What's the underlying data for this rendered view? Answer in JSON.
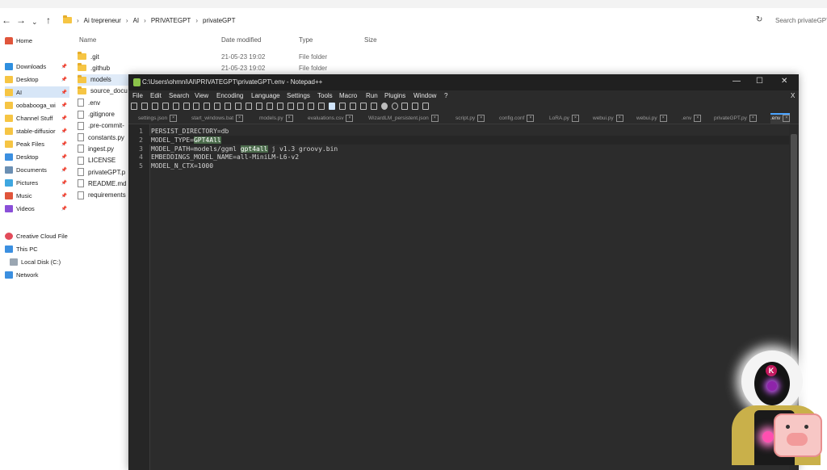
{
  "explorer": {
    "breadcrumbs": [
      "Ai trepreneur",
      "AI",
      "PRIVATEGPT",
      "privateGPT"
    ],
    "search_placeholder": "Search privateGPT",
    "columns": {
      "name": "Name",
      "date": "Date modified",
      "type": "Type",
      "size": "Size"
    },
    "sidebar": {
      "home": "Home",
      "quick_access": [
        {
          "label": "Downloads",
          "color": "#2f8fdf"
        },
        {
          "label": "Desktop",
          "color": "#f6c544"
        },
        {
          "label": "AI",
          "color": "#f6c544"
        },
        {
          "label": "oobabooga_wi",
          "color": "#f6c544"
        },
        {
          "label": "Channel Stuff",
          "color": "#f6c544"
        },
        {
          "label": "stable-diffusior",
          "color": "#f6c544"
        },
        {
          "label": "Peak Files",
          "color": "#f6c544"
        },
        {
          "label": "Desktop",
          "color": "#3b8fe0"
        },
        {
          "label": "Documents",
          "color": "#6b8fb3"
        },
        {
          "label": "Pictures",
          "color": "#3fa7e0"
        },
        {
          "label": "Music",
          "color": "#e0553b"
        },
        {
          "label": "Videos",
          "color": "#8a4fd8"
        }
      ],
      "creative_cloud": "Creative Cloud File",
      "this_pc": "This PC",
      "local_disk": "Local Disk (C:)",
      "network": "Network"
    },
    "files": [
      {
        "name": ".git",
        "kind": "folder",
        "date": "21-05-23 19:02",
        "type": "File folder"
      },
      {
        "name": ".github",
        "kind": "folder",
        "date": "21-05-23 19:02",
        "type": "File folder"
      },
      {
        "name": "models",
        "kind": "folder",
        "date": "",
        "type": ""
      },
      {
        "name": "source_docu",
        "kind": "folder",
        "date": "",
        "type": ""
      },
      {
        "name": ".env",
        "kind": "file",
        "date": "",
        "type": ""
      },
      {
        "name": ".gitignore",
        "kind": "file",
        "date": "",
        "type": ""
      },
      {
        "name": ".pre-commit-",
        "kind": "file",
        "date": "",
        "type": ""
      },
      {
        "name": "constants.py",
        "kind": "file",
        "date": "",
        "type": ""
      },
      {
        "name": "ingest.py",
        "kind": "file",
        "date": "",
        "type": ""
      },
      {
        "name": "LICENSE",
        "kind": "file",
        "date": "",
        "type": ""
      },
      {
        "name": "privateGPT.p",
        "kind": "file",
        "date": "",
        "type": ""
      },
      {
        "name": "README.md",
        "kind": "file",
        "date": "",
        "type": ""
      },
      {
        "name": "requirements",
        "kind": "file",
        "date": "",
        "type": ""
      }
    ]
  },
  "notepad": {
    "title": "C:\\Users\\ohmni\\AI\\PRIVATEGPT\\privateGPT\\.env - Notepad++",
    "menu": [
      "File",
      "Edit",
      "Search",
      "View",
      "Encoding",
      "Language",
      "Settings",
      "Tools",
      "Macro",
      "Run",
      "Plugins",
      "Window",
      "?"
    ],
    "close_x": "X",
    "tabs": [
      "settings.json",
      "start_windows.bat",
      "models.py",
      "evaluations.csv",
      "WizardLM_persistent.json",
      "script.py",
      "config.conf",
      "LoRA.py",
      "webui.py",
      "webui.py",
      ".env",
      "privateGPT.py",
      ".env"
    ],
    "active_tab": 12,
    "lines": [
      {
        "num": "1",
        "pre": "PERSIST_DIRECTORY=db",
        "hl": "",
        "post": ""
      },
      {
        "num": "2",
        "pre": "MODEL_TYPE=",
        "hl": "GPT4All",
        "post": ""
      },
      {
        "num": "3",
        "pre": "MODEL_PATH=models/ggml ",
        "hl": "gpt4all",
        "post": " j v1.3 groovy.bin"
      },
      {
        "num": "4",
        "pre": "EMBEDDINGS_MODEL_NAME=all-MiniLM-L6-v2",
        "hl": "",
        "post": ""
      },
      {
        "num": "5",
        "pre": "MODEL_N_CTX=1000",
        "hl": "",
        "post": ""
      }
    ]
  },
  "overlay": {
    "badge": "K"
  }
}
